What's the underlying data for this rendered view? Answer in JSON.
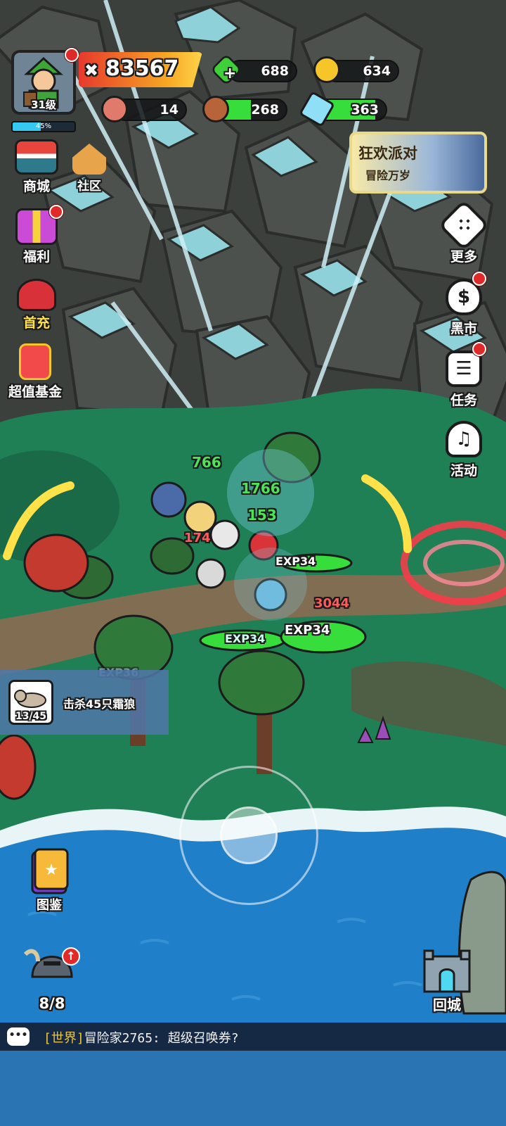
{
  "player": {
    "level_label": "31级",
    "xp_percent": 45,
    "xp_label": "45%",
    "power": "83567"
  },
  "resources": {
    "gems": "688",
    "gold": "634",
    "meat": "14",
    "wood": "268",
    "crystal": "363",
    "wood_fill": 0.5,
    "crystal_fill": 0.85
  },
  "left_menu": {
    "shop": "商城",
    "community": "社区",
    "welfare": "福利",
    "first_recharge": "首充",
    "fund": "超值基金"
  },
  "right_menu": {
    "more": "更多",
    "black_market": "黑市",
    "tasks": "任务",
    "events": "活动"
  },
  "event_banner": {
    "title": "狂欢派对",
    "subtitle": "冒险万岁"
  },
  "battle_numbers": {
    "n1": "766",
    "n2": "1766",
    "n3": "153",
    "n4": "174",
    "n5": "3044",
    "n6": "EXP34",
    "n7": "EXP34",
    "n8": "EXP34",
    "n9": "EXP36"
  },
  "quest": {
    "progress": "13/45",
    "text": "击杀45只霜狼"
  },
  "bottom": {
    "codex": "图鉴",
    "hero_count": "8/8",
    "return_town": "回城"
  },
  "chat": {
    "channel": "[世界]",
    "message": "冒险家2765: 超级召唤券?"
  },
  "colors": {
    "grass": "#1f7f55",
    "sea": "#1f7fc8",
    "xp_blue": "#35c8f0",
    "resource_green": "#37dd3a"
  }
}
